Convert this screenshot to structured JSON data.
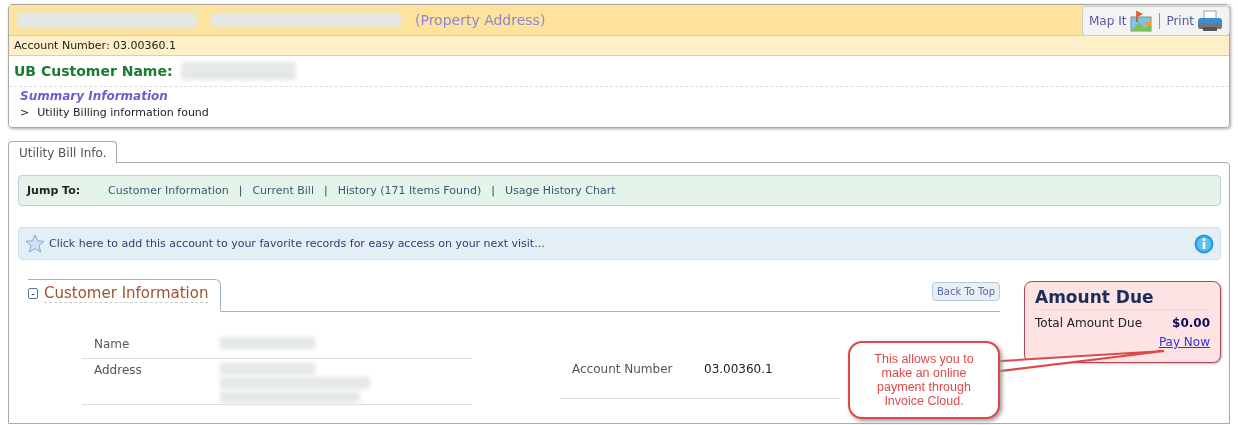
{
  "header": {
    "title": "(Property Address)",
    "account_number": "Account Number: 03.00360.1",
    "actions": [
      {
        "label": "Map It",
        "kind": "map"
      },
      {
        "label": "Print",
        "kind": "print"
      }
    ],
    "customer_label": "UB Customer Name:",
    "summary_title": "Summary Information",
    "summary_items": [
      {
        "marker": ">",
        "text": "Utility Billing information found"
      }
    ]
  },
  "tabs": [
    {
      "label": "Utility Bill Info.",
      "selected": true
    }
  ],
  "jump": {
    "label": "Jump To:",
    "separator": "|",
    "links": [
      "Customer Information",
      "Current Bill",
      "History (171 Items Found)",
      "Usage History Chart"
    ]
  },
  "favorites": {
    "text": "Click here to add this account to your favorite records for easy access on your next visit..."
  },
  "section": {
    "toggle": "-",
    "title": "Customer Information",
    "back_to_top": "Back To Top",
    "fields": [
      {
        "label": "Name"
      },
      {
        "label": "Address"
      }
    ],
    "account": {
      "label": "Account Number",
      "value": "03.00360.1"
    }
  },
  "amount_due": {
    "title": "Amount Due",
    "label": "Total Amount Due",
    "value": "$0.00",
    "link": "Pay Now"
  },
  "callout": {
    "text": "This allows you to make an online payment through Invoice Cloud."
  }
}
